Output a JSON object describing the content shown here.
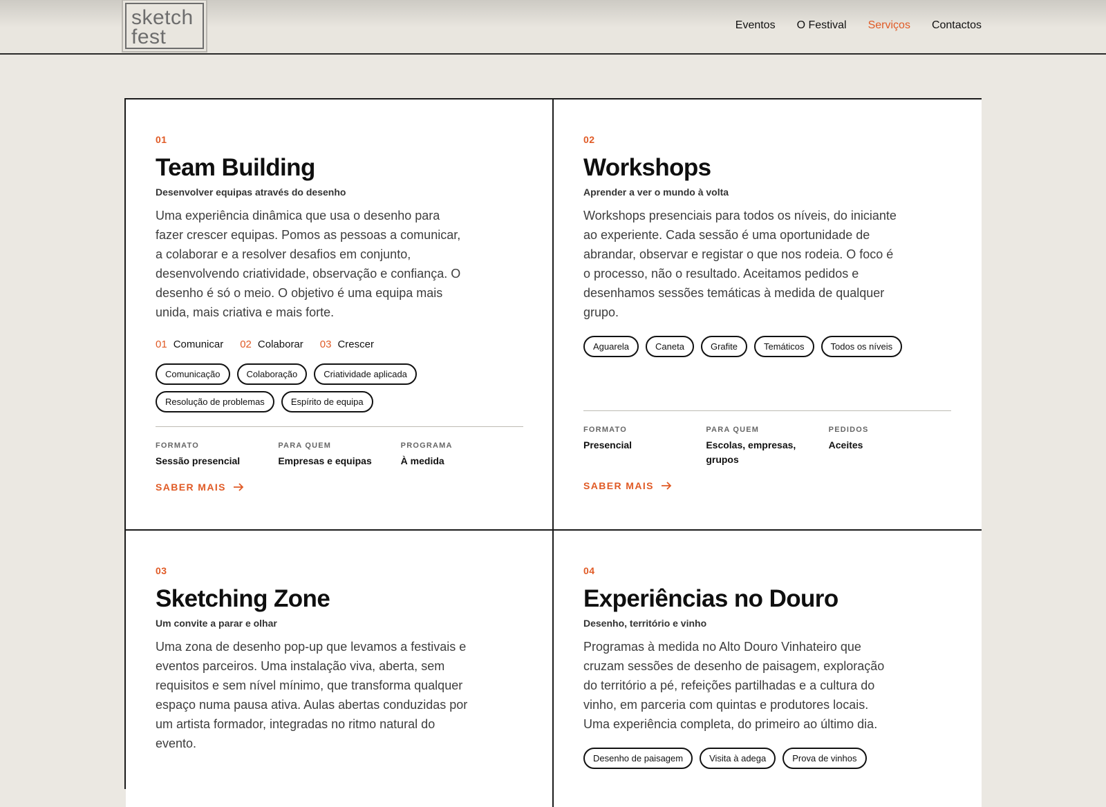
{
  "logo": {
    "line1": "sketch",
    "line2": "fest"
  },
  "nav": {
    "items": [
      {
        "label": "Eventos"
      },
      {
        "label": "O Festival"
      },
      {
        "label": "Serviços"
      },
      {
        "label": "Contactos"
      }
    ],
    "active": "Serviços"
  },
  "colors": {
    "accent": "#e05a25",
    "background": "#ebe8e2",
    "ink": "#111111"
  },
  "cards": [
    {
      "num": "01",
      "title": "Team Building",
      "subtitle": "Desenvolver equipas através do desenho",
      "desc": "Uma experiência dinâmica que usa o desenho para fazer crescer equipas. Pomos as pessoas a comunicar, a colaborar e a resolver desafios em conjunto, desenvolvendo criatividade, observação e confiança. O desenho é só o meio. O objetivo é uma equipa mais unida, mais criativa e mais forte.",
      "steps": [
        {
          "num": "01",
          "label": "Comunicar"
        },
        {
          "num": "02",
          "label": "Colaborar"
        },
        {
          "num": "03",
          "label": "Crescer"
        }
      ],
      "tags": [
        "Comunicação",
        "Colaboração",
        "Criatividade aplicada",
        "Resolução de problemas",
        "Espírito de equipa"
      ],
      "meta": [
        {
          "label": "FORMATO",
          "value": "Sessão presencial"
        },
        {
          "label": "PARA QUEM",
          "value": "Empresas e equipas"
        },
        {
          "label": "PROGRAMA",
          "value": "À medida"
        }
      ],
      "more": "SABER MAIS"
    },
    {
      "num": "02",
      "title": "Workshops",
      "subtitle": "Aprender a ver o mundo à volta",
      "desc": "Workshops presenciais para todos os níveis, do iniciante ao experiente. Cada sessão é uma oportunidade de abrandar, observar e registar o que nos rodeia. O foco é o processo, não o resultado. Aceitamos pedidos e desenhamos sessões temáticas à medida de qualquer grupo.",
      "tags": [
        "Aguarela",
        "Caneta",
        "Grafite",
        "Temáticos",
        "Todos os níveis"
      ],
      "meta": [
        {
          "label": "FORMATO",
          "value": "Presencial"
        },
        {
          "label": "PARA QUEM",
          "value": "Escolas, empresas, grupos"
        },
        {
          "label": "PEDIDOS",
          "value": "Aceites"
        }
      ],
      "more": "SABER MAIS"
    },
    {
      "num": "03",
      "title": "Sketching Zone",
      "subtitle": "Um convite a parar e olhar",
      "desc": "Uma zona de desenho pop-up que levamos a festivais e eventos parceiros. Uma instalação viva, aberta, sem requisitos e sem nível mínimo, que transforma qualquer espaço numa pausa ativa. Aulas abertas conduzidas por um artista formador, integradas no ritmo natural do evento."
    },
    {
      "num": "04",
      "title": "Experiências no Douro",
      "subtitle": "Desenho, território e vinho",
      "desc": "Programas à medida no Alto Douro Vinhateiro que cruzam sessões de desenho de paisagem, exploração do território a pé, refeições partilhadas e a cultura do vinho, em parceria com quintas e produtores locais. Uma experiência completa, do primeiro ao último dia.",
      "tags": [
        "Desenho de paisagem",
        "Visita à adega",
        "Prova de vinhos"
      ]
    }
  ]
}
